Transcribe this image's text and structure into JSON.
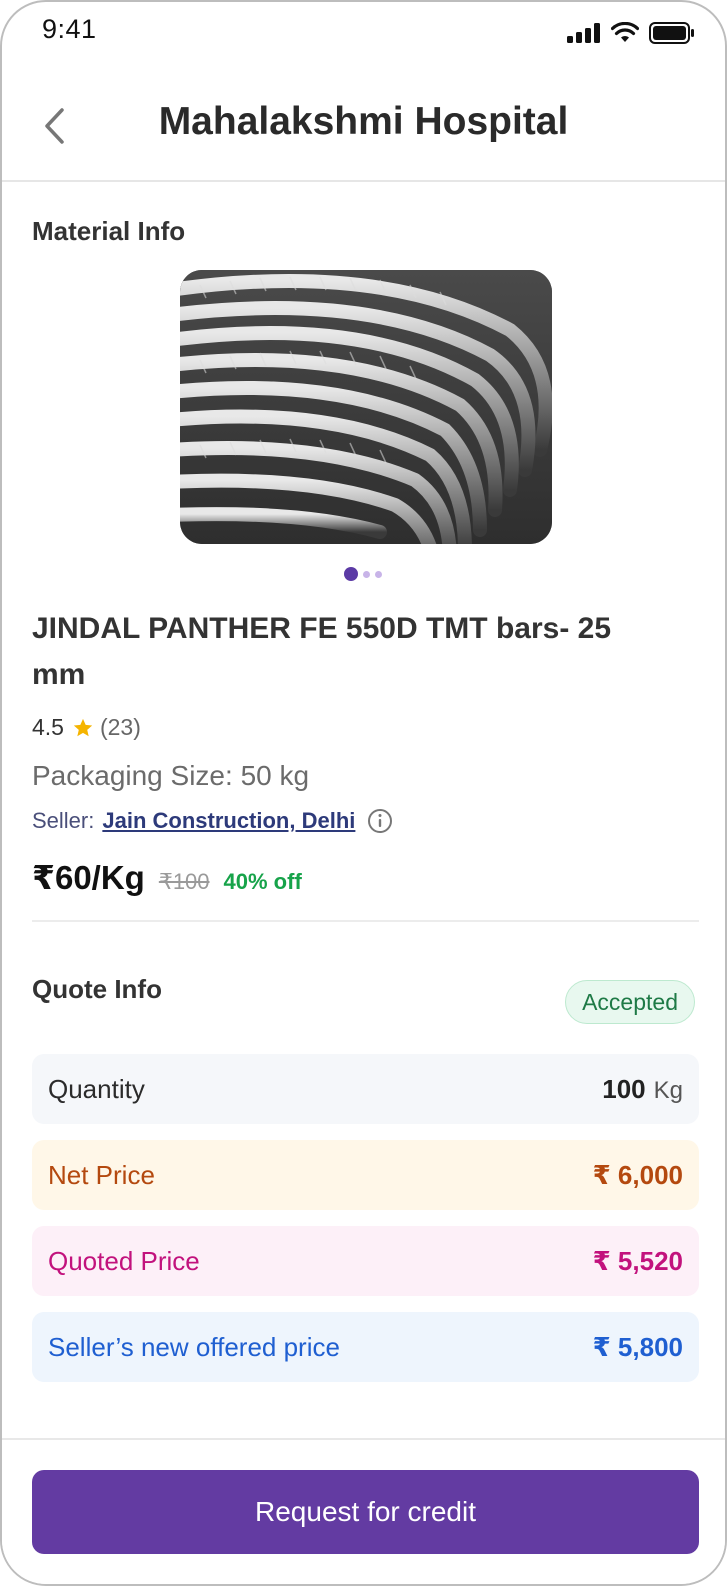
{
  "status_bar": {
    "time": "9:41"
  },
  "header": {
    "title": "Mahalakshmi Hospital"
  },
  "material": {
    "section_label": "Material Info",
    "product_name": "JINDAL PANTHER FE 550D TMT bars- 25 mm",
    "rating": "4.5",
    "rating_count": "(23)",
    "packaging": "Packaging Size: 50 kg",
    "seller_label": "Seller:",
    "seller_name": "Jain Construction, Delhi",
    "price": "₹60/Kg",
    "original_price": "₹100",
    "discount": "40% off"
  },
  "quote": {
    "section_label": "Quote Info",
    "status": "Accepted",
    "quantity_label": "Quantity",
    "quantity_value": "100",
    "quantity_unit": "Kg",
    "net_price_label": "Net Price",
    "net_price_value": "₹ 6,000",
    "quoted_price_label": "Quoted Price",
    "quoted_price_value": "₹ 5,520",
    "seller_offer_label": "Seller’s new offered price",
    "seller_offer_value": "₹ 5,800"
  },
  "cta": {
    "label": "Request for credit"
  },
  "colors": {
    "brand": "#633ba2",
    "accepted": "#1e7a46",
    "net_price": "#b4490f",
    "quoted_price": "#c2127d",
    "seller_offer": "#1f5fd1",
    "discount": "#17a34a"
  },
  "icons": [
    "signal-icon",
    "wifi-icon",
    "battery-icon",
    "back-arrow-icon",
    "star-icon",
    "info-icon"
  ]
}
